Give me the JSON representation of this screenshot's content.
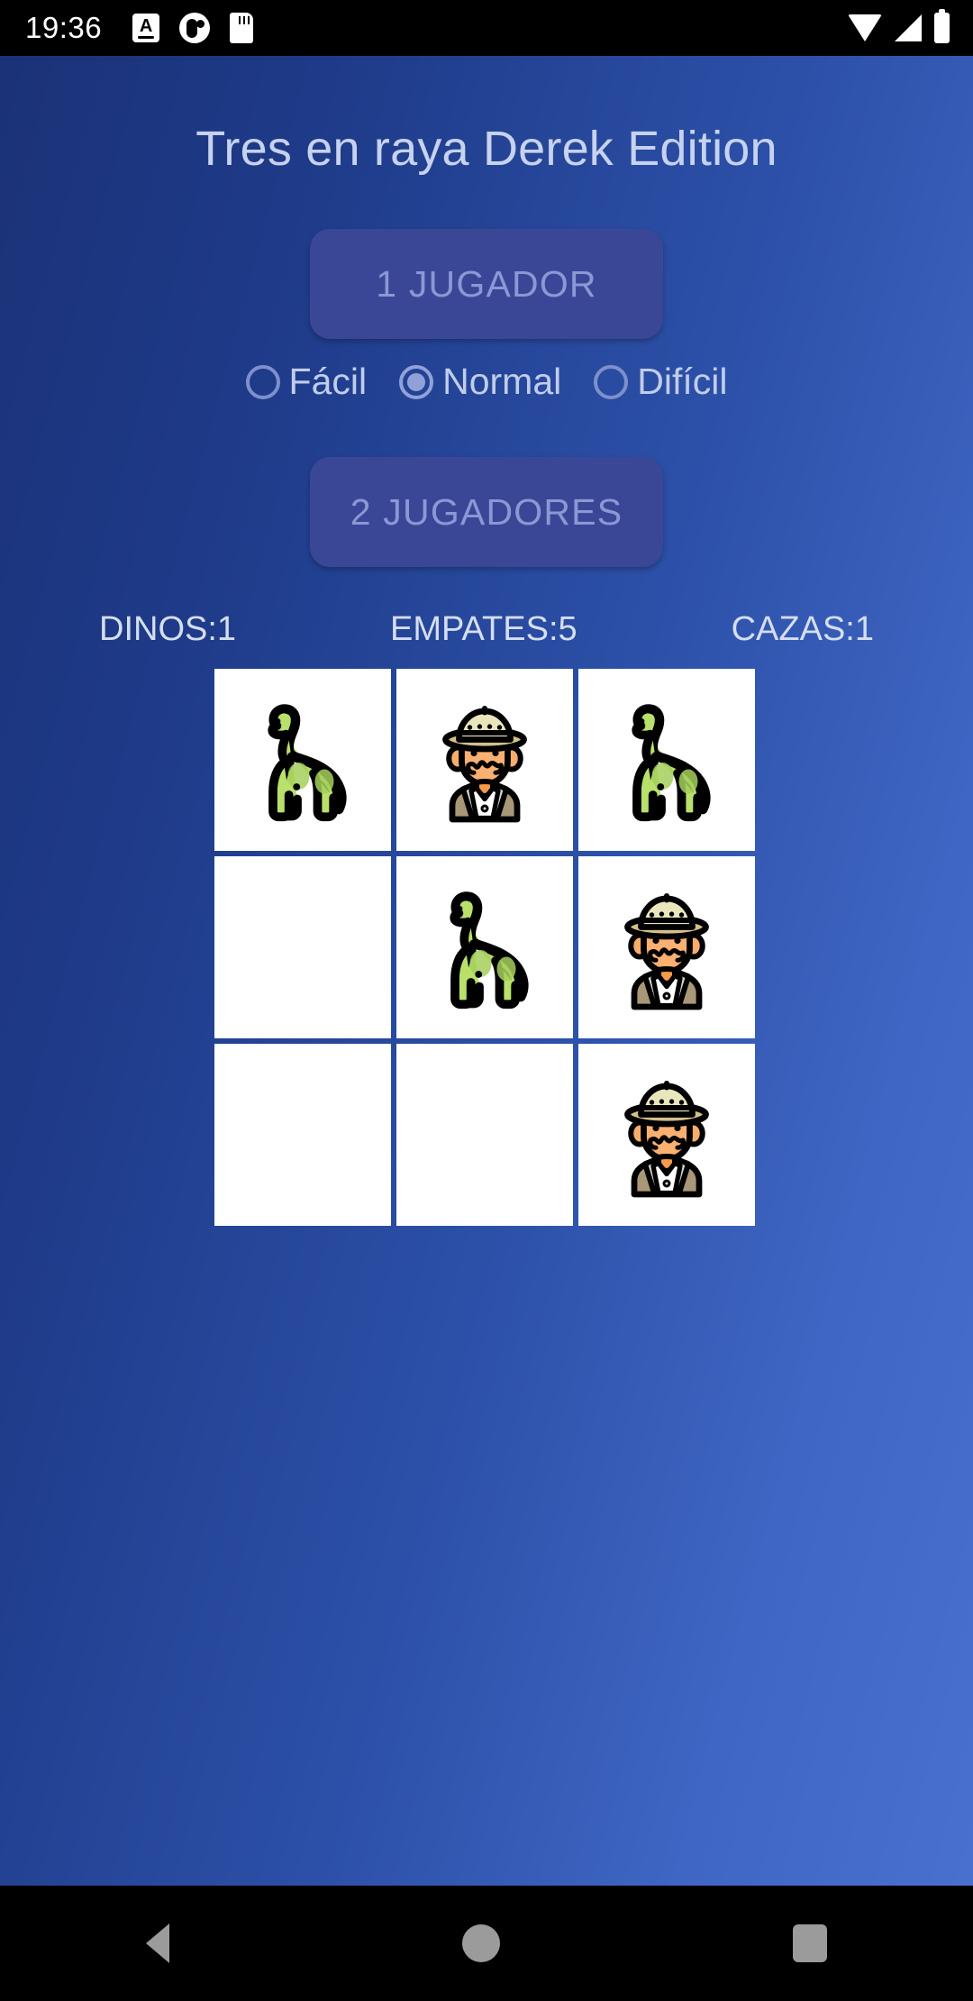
{
  "status_bar": {
    "time": "19:36",
    "notification_icons": [
      "keyboard-icon",
      "app-circle-icon",
      "sd-card-icon"
    ],
    "right_icons": [
      "wifi-icon",
      "cellular-signal-icon",
      "battery-icon"
    ]
  },
  "app": {
    "title": "Tres en raya Derek Edition",
    "one_player_button": "1 JUGADOR",
    "two_players_button": "2 JUGADORES",
    "difficulty": {
      "options": [
        {
          "label": "Fácil",
          "selected": false
        },
        {
          "label": "Normal",
          "selected": true
        },
        {
          "label": "Difícil",
          "selected": false
        }
      ]
    },
    "scores": [
      {
        "label": "DINOS:1"
      },
      {
        "label": "EMPATES:5"
      },
      {
        "label": "CAZAS:1"
      }
    ],
    "board": {
      "cells": [
        {
          "mark": "dino"
        },
        {
          "mark": "hunter"
        },
        {
          "mark": "dino"
        },
        {
          "mark": ""
        },
        {
          "mark": "dino"
        },
        {
          "mark": "hunter"
        },
        {
          "mark": ""
        },
        {
          "mark": ""
        },
        {
          "mark": "hunter"
        }
      ]
    },
    "colors": {
      "background_dark": "#1b3277",
      "background_light": "#4a70cf",
      "button_fill": "#3a4797",
      "button_text": "#8a98d4",
      "title_text": "#c6d2ef",
      "score_text": "#d5deef",
      "radio_accent": "#8fa2d8",
      "cell_background": "#ffffff",
      "dino_green": "#a8d65c",
      "hunter_skin": "#f5a763",
      "hunter_hat": "#e8e3b4"
    }
  },
  "nav_bar": {
    "items": [
      "back-button",
      "home-button",
      "recents-button"
    ]
  }
}
